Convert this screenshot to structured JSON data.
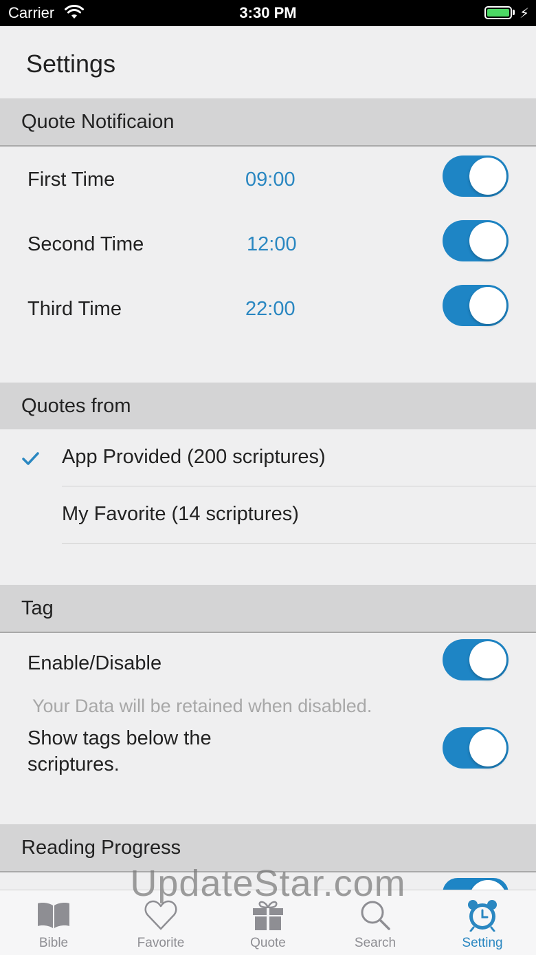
{
  "status_bar": {
    "carrier": "Carrier",
    "time": "3:30 PM"
  },
  "nav": {
    "title": "Settings"
  },
  "sections": {
    "quote_notification": {
      "header": "Quote Notificaion",
      "rows": [
        {
          "label": "First Time",
          "time": "09:00",
          "enabled": true
        },
        {
          "label": "Second Time",
          "time": "12:00",
          "enabled": true
        },
        {
          "label": "Third Time",
          "time": "22:00",
          "enabled": true
        }
      ]
    },
    "quotes_from": {
      "header": "Quotes from",
      "options": [
        {
          "label": "App Provided (200 scriptures)",
          "selected": true
        },
        {
          "label": "My Favorite (14 scriptures)",
          "selected": false
        }
      ]
    },
    "tag": {
      "header": "Tag",
      "enable_label": "Enable/Disable",
      "enable_on": true,
      "note": "Your Data will be retained when disabled.",
      "show_tags_line1": "Show tags below the",
      "show_tags_line2": "scriptures.",
      "show_tags_on": true
    },
    "reading_progress": {
      "header": "Reading Progress"
    }
  },
  "watermark": "UpdateStar.com",
  "tabs": [
    {
      "label": "Bible",
      "icon": "book-icon",
      "active": false
    },
    {
      "label": "Favorite",
      "icon": "heart-icon",
      "active": false
    },
    {
      "label": "Quote",
      "icon": "gift-icon",
      "active": false
    },
    {
      "label": "Search",
      "icon": "search-icon",
      "active": false
    },
    {
      "label": "Setting",
      "icon": "alarm-clock-icon",
      "active": true
    }
  ],
  "colors": {
    "accent": "#2a87c1",
    "toggle_on": "#1e85c5",
    "section_header_bg": "#d4d4d5",
    "page_bg": "#efeff0",
    "inactive_tab": "#8e8e93"
  }
}
